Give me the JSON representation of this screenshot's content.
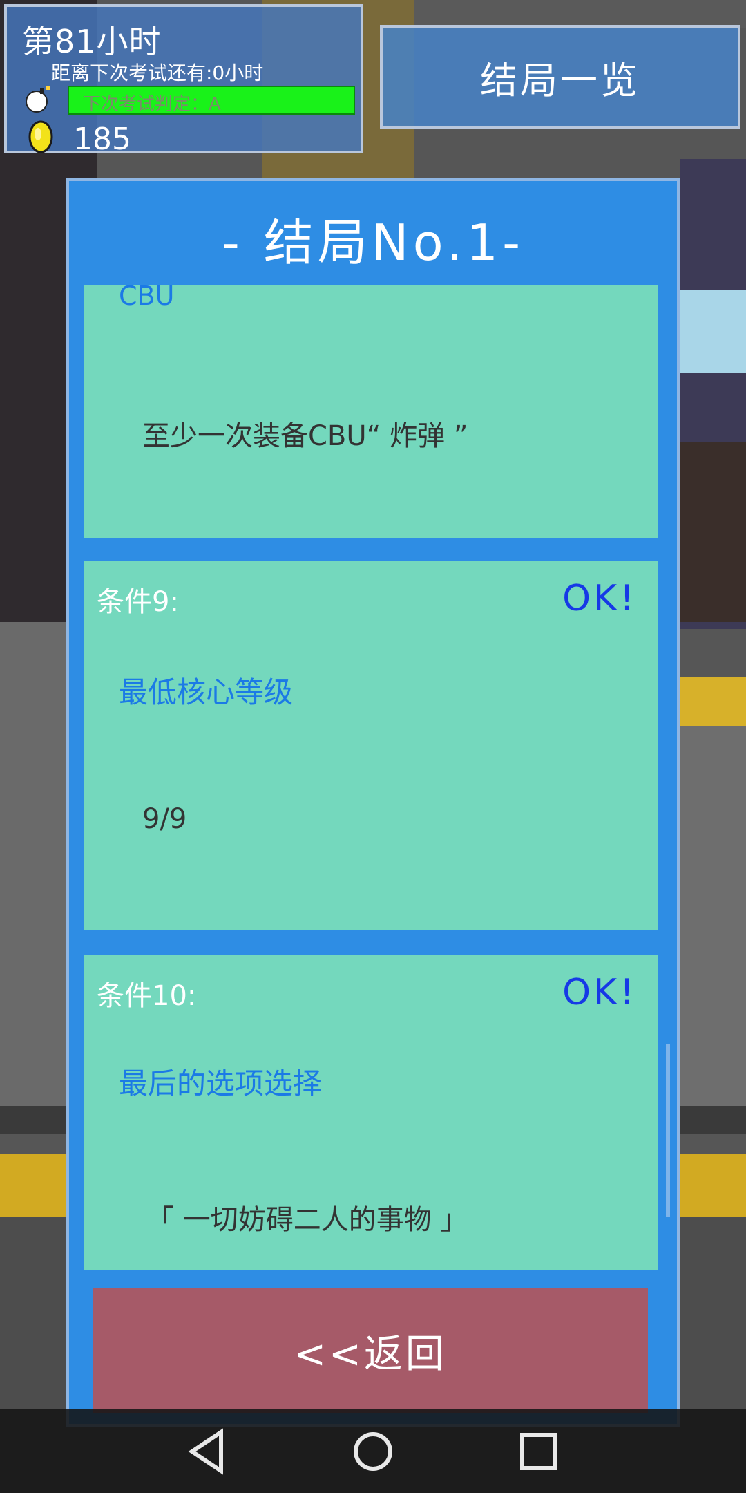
{
  "hud": {
    "hour": "第81小时",
    "next_exam": "距离下次考试还有:0小时",
    "grade": "下次考试判定：A",
    "coins": "185"
  },
  "header": {
    "ending_list": "结局一览"
  },
  "panel": {
    "title": "- 结局No.1-",
    "partial_card": {
      "name": "CBU",
      "detail": "至少一次装备CBU“ 炸弹 ”"
    },
    "conditions": [
      {
        "label": "条件9:",
        "status": "OK!",
        "name": "最低核心等级",
        "detail": "9/9"
      },
      {
        "label": "条件10:",
        "status": "OK!",
        "name": "最后的选项选择",
        "detail": "「 一切妨碍二人的事物 」"
      }
    ],
    "back": "<<返回"
  },
  "icons": {
    "bomb": "bomb-icon",
    "coin": "coin-icon",
    "nav_back": "triangle-back-icon",
    "nav_home": "circle-home-icon",
    "nav_recent": "square-recent-icon"
  },
  "colors": {
    "panel": "#2e8de4",
    "card": "#74d8bd",
    "ok": "#1639e6",
    "condition_name": "#1b7ae6",
    "grade_bar": "#19f219",
    "back_button": "#a65a68"
  }
}
